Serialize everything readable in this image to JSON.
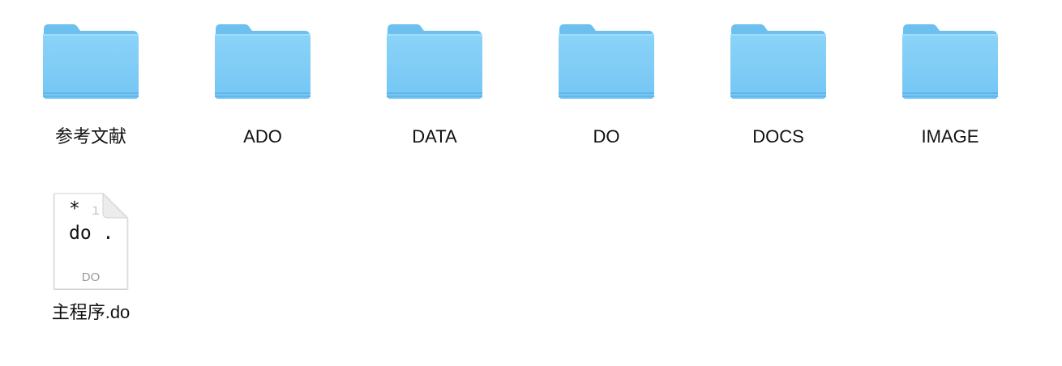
{
  "folders": [
    {
      "label": "参考文献",
      "icon": "folder-icon"
    },
    {
      "label": "ADO",
      "icon": "folder-icon"
    },
    {
      "label": "DATA",
      "icon": "folder-icon"
    },
    {
      "label": "DO",
      "icon": "folder-icon"
    },
    {
      "label": "DOCS",
      "icon": "folder-icon"
    },
    {
      "label": "IMAGE",
      "icon": "folder-icon"
    }
  ],
  "files": [
    {
      "label": "主程序.do",
      "icon": "do-document-icon",
      "preview_line1": "* ",
      "preview_line2": "do .",
      "extension": "DO"
    }
  ],
  "colors": {
    "folder_body": "#7fcdf7",
    "folder_back": "#6bbef0",
    "folder_tab": "#8fd4f7",
    "folder_edge": "#5aaee6"
  }
}
